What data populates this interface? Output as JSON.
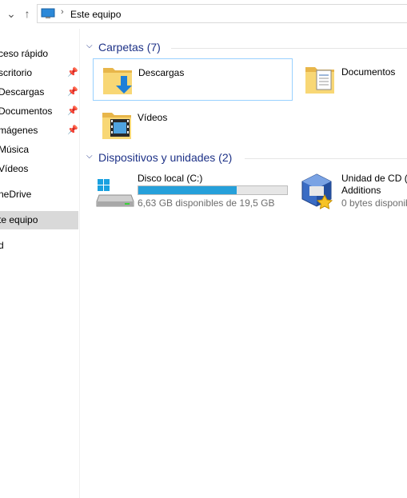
{
  "address": {
    "back_icon": "back-arrow-icon",
    "up_icon": "up-arrow-icon",
    "location_icon": "this-pc-icon",
    "breadcrumb": "Este equipo"
  },
  "sidebar": {
    "items": [
      {
        "label": "ceso rápido",
        "pinned": false
      },
      {
        "label": "scritorio",
        "pinned": true
      },
      {
        "label": "Descargas",
        "pinned": true
      },
      {
        "label": "Documentos",
        "pinned": true
      },
      {
        "label": "mágenes",
        "pinned": true
      },
      {
        "label": "Música",
        "pinned": false
      },
      {
        "label": "Vídeos",
        "pinned": false
      },
      {
        "label": "neDrive",
        "pinned": false
      },
      {
        "label": "te equipo",
        "pinned": false,
        "selected": true
      },
      {
        "label": "d",
        "pinned": false
      }
    ]
  },
  "groups": {
    "folders": {
      "title": "Carpetas (7)",
      "items": [
        {
          "name": "Descargas",
          "icon": "downloads-folder-icon"
        },
        {
          "name": "Documentos",
          "icon": "documents-folder-icon"
        },
        {
          "name": "Vídeos",
          "icon": "videos-folder-icon"
        }
      ]
    },
    "devices": {
      "title": "Dispositivos y unidades (2)",
      "items": [
        {
          "name": "Disco local (C:)",
          "detail": "6,63 GB disponibles de 19,5 GB",
          "used_fraction": 0.66,
          "icon": "windows-drive-icon"
        },
        {
          "name_line1": "Unidad de CD (I",
          "name_line2": "Additions",
          "detail": "0 bytes disponib",
          "icon": "virtualbox-cd-icon"
        }
      ]
    }
  },
  "colors": {
    "accent": "#1e3287",
    "selection": "#99d1ff",
    "progress": "#26a0da"
  }
}
